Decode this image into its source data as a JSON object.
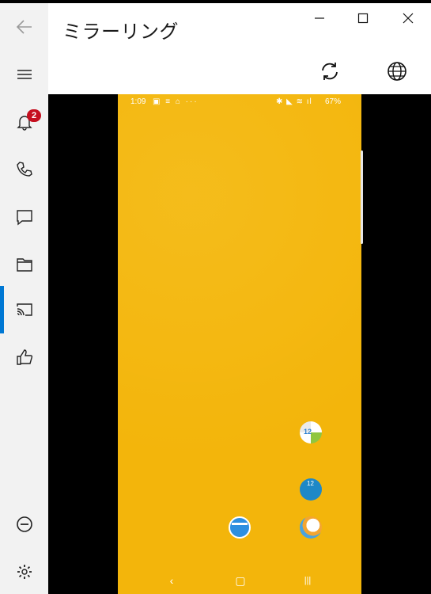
{
  "window": {
    "title": "ミラーリング",
    "controls": [
      "minimize",
      "maximize",
      "close"
    ]
  },
  "header_actions": {
    "refresh_icon": "refresh-icon",
    "globe_icon": "globe-icon"
  },
  "rail": {
    "items": [
      {
        "name": "back",
        "icon": "back-arrow-icon"
      },
      {
        "name": "menu",
        "icon": "hamburger-icon"
      },
      {
        "name": "notifications",
        "icon": "bell-icon",
        "badge": "2"
      },
      {
        "name": "calls",
        "icon": "phone-icon"
      },
      {
        "name": "messages",
        "icon": "message-icon"
      },
      {
        "name": "files",
        "icon": "folder-icon"
      },
      {
        "name": "mirroring",
        "icon": "cast-icon",
        "active": true
      },
      {
        "name": "feedback",
        "icon": "thumbs-up-icon"
      },
      {
        "name": "do-not-disturb",
        "icon": "minus-circle-icon"
      },
      {
        "name": "settings",
        "icon": "gear-icon"
      }
    ],
    "accent_color": "#0078d4"
  },
  "phone": {
    "status_bar": {
      "time": "1:09",
      "left_icons": "▣ ≡ ⌂ ···",
      "right_icons": "✱ ◣ ≋ ıl",
      "battery": "67%"
    },
    "wallpaper_color": "#f3b50b",
    "nav_buttons": [
      "‹",
      "▢",
      "|||"
    ],
    "apps": [
      {
        "name": "calendar-widget",
        "label": "12"
      },
      {
        "name": "clock-widget",
        "label": "12"
      },
      {
        "name": "dock-app-blue"
      },
      {
        "name": "weather-app"
      }
    ]
  }
}
